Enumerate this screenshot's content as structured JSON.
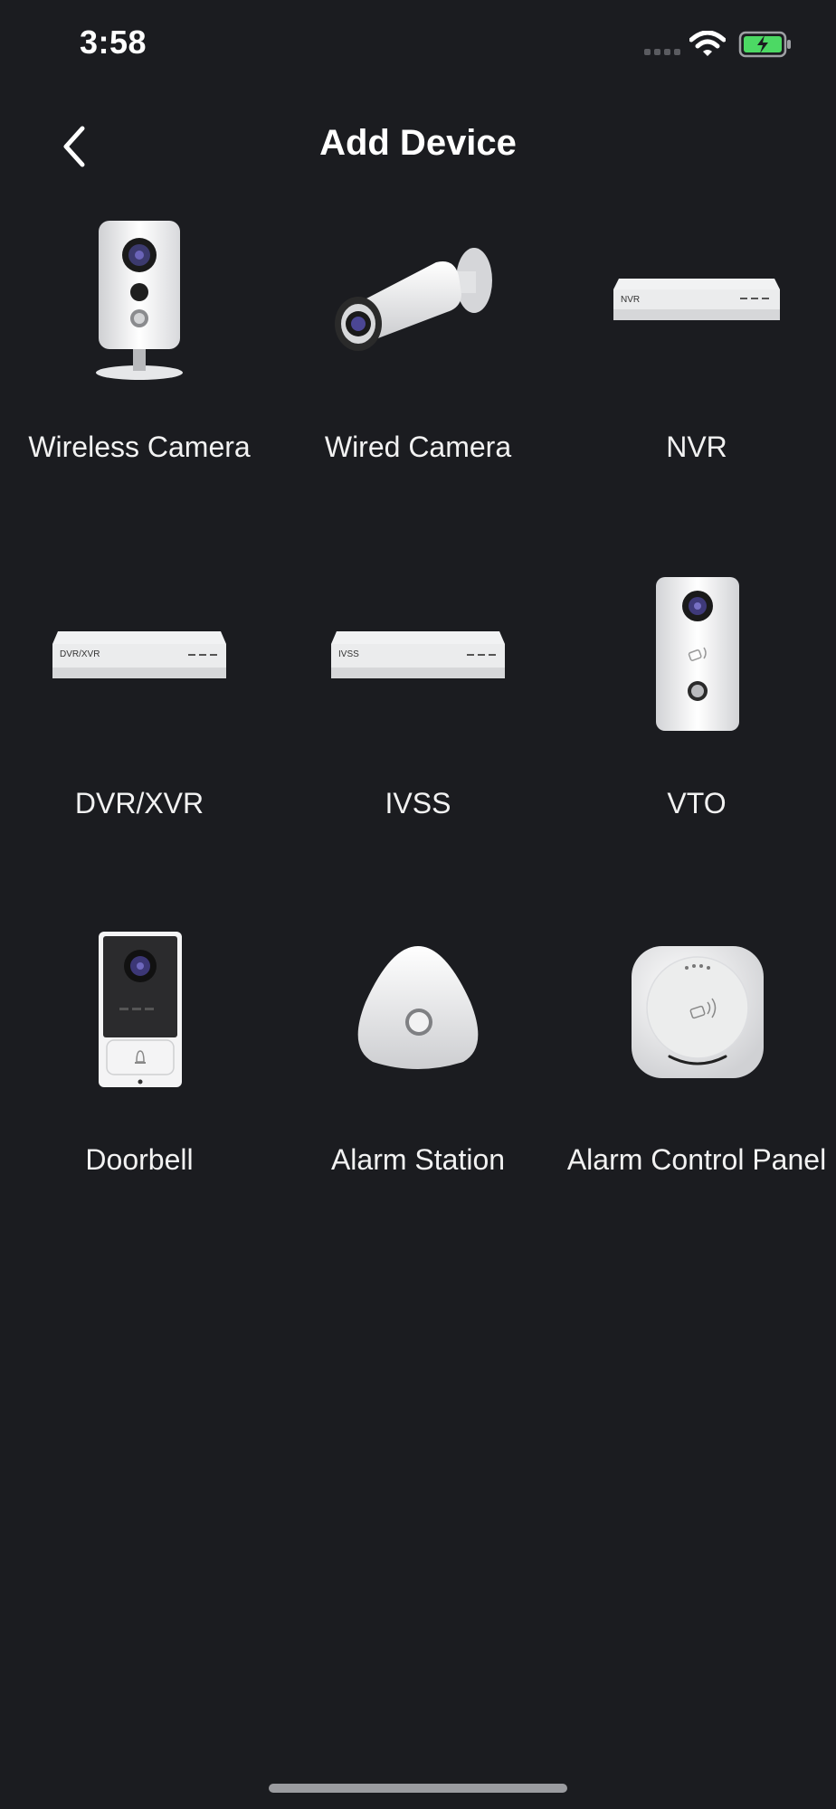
{
  "status_bar": {
    "time": "3:58"
  },
  "header": {
    "title": "Add Device"
  },
  "devices": [
    {
      "label": "Wireless Camera",
      "icon": "wireless-camera-icon"
    },
    {
      "label": "Wired Camera",
      "icon": "bullet-camera-icon"
    },
    {
      "label": "NVR",
      "icon": "nvr-recorder-icon",
      "badge": "NVR"
    },
    {
      "label": "DVR/XVR",
      "icon": "dvr-recorder-icon",
      "badge": "DVR/XVR"
    },
    {
      "label": "IVSS",
      "icon": "ivss-recorder-icon",
      "badge": "IVSS"
    },
    {
      "label": "VTO",
      "icon": "vto-intercom-icon"
    },
    {
      "label": "Doorbell",
      "icon": "doorbell-icon"
    },
    {
      "label": "Alarm Station",
      "icon": "alarm-station-icon"
    },
    {
      "label": "Alarm Control Panel",
      "icon": "alarm-control-panel-icon"
    }
  ],
  "colors": {
    "background": "#1b1c20",
    "battery_fill": "#4cd964"
  }
}
